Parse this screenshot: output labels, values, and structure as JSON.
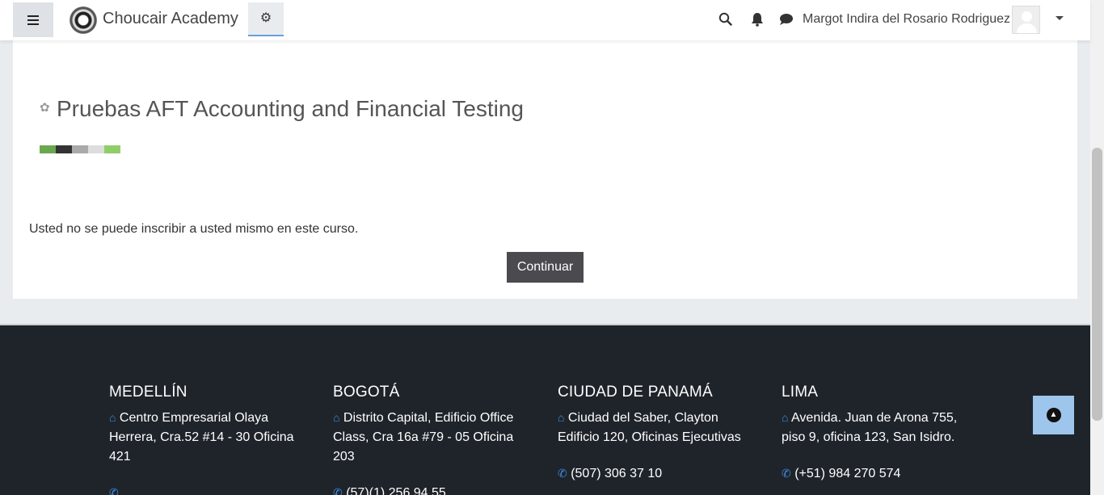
{
  "navbar": {
    "menu_icon": "hamburger-icon",
    "brand_name": "Choucair Academy",
    "admin_icon": "cogs-icon",
    "search_icon": "search-icon",
    "notifications_icon": "bell-icon",
    "messages_icon": "chat-icon",
    "user_name": "Margot Indira del Rosario Rodriguez",
    "user_menu_icon": "caret-down-icon"
  },
  "main": {
    "course_title": "Pruebas AFT Accounting and Financial Testing",
    "enrol_message": "Usted no se puede inscribir a usted mismo en este curso.",
    "continue_label": "Continuar"
  },
  "footer": {
    "columns": [
      {
        "city": "MEDELLÍN",
        "address": "Centro Empresarial Olaya Herrera, Cra.52 #14 - 30 Oficina 421"
      },
      {
        "city": "BOGOTÁ",
        "address": "Distrito Capital, Edificio Office Class, Cra 16a #79 - 05 Oficina 203",
        "phone": "(57)(1) 256 94 55"
      },
      {
        "city": "CIUDAD DE PANAMÁ",
        "address": "Ciudad del Saber, Clayton Edificio 120, Oficinas Ejecutivas",
        "phone": "(507) 306 37 10"
      },
      {
        "city": "LIMA",
        "address": "Avenida. Juan de Arona 755, piso 9, oficina 123, San Isidro.",
        "phone": "(+51) 984 270 574"
      }
    ],
    "back_to_top_icon": "arrow-up-circle-icon"
  },
  "colors": {
    "accent": "#3f8de6",
    "footer_bg": "#1f242b",
    "button_bg": "#4a4a4f",
    "back_to_top_bg": "#9ec5eb"
  }
}
